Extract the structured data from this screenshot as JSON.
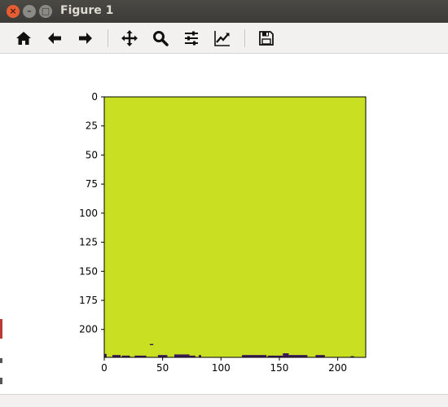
{
  "window": {
    "title": "Figure 1",
    "close_glyph": "×",
    "minimize_glyph": "–",
    "maximize_glyph": "□"
  },
  "toolbar": {
    "buttons": [
      {
        "name": "home-icon",
        "tooltip": ""
      },
      {
        "name": "back-arrow-icon",
        "tooltip": ""
      },
      {
        "name": "forward-arrow-icon",
        "tooltip": ""
      },
      {
        "name": "pan-move-icon",
        "tooltip": ""
      },
      {
        "name": "zoom-magnifier-icon",
        "tooltip": ""
      },
      {
        "name": "configure-subplots-icon",
        "tooltip": ""
      },
      {
        "name": "edit-axis-line-icon",
        "tooltip": ""
      },
      {
        "name": "save-floppy-icon",
        "tooltip": ""
      }
    ]
  },
  "colors": {
    "image_fill": "#c8e021",
    "dark_pixels": "#3b1a55",
    "axis": "#000000"
  },
  "chart_data": {
    "type": "heatmap",
    "title": "",
    "xlabel": "",
    "ylabel": "",
    "xlim": [
      0,
      224
    ],
    "ylim": [
      224,
      0
    ],
    "xticks": [
      0,
      50,
      100,
      150,
      200
    ],
    "yticks": [
      0,
      25,
      50,
      75,
      100,
      125,
      150,
      175,
      200
    ],
    "grid": false,
    "fill_value": "high",
    "dark_regions": [
      {
        "x0": 0,
        "x1": 2,
        "y0": 221,
        "y1": 224
      },
      {
        "x0": 7,
        "x1": 14,
        "y0": 222,
        "y1": 224
      },
      {
        "x0": 15,
        "x1": 22,
        "y0": 222.5,
        "y1": 224
      },
      {
        "x0": 26,
        "x1": 36,
        "y0": 222.5,
        "y1": 224
      },
      {
        "x0": 39,
        "x1": 42,
        "y0": 212.5,
        "y1": 213.5
      },
      {
        "x0": 46,
        "x1": 54,
        "y0": 222,
        "y1": 224
      },
      {
        "x0": 60,
        "x1": 73,
        "y0": 221.5,
        "y1": 224
      },
      {
        "x0": 73,
        "x1": 78,
        "y0": 222.5,
        "y1": 224
      },
      {
        "x0": 81,
        "x1": 83,
        "y0": 222,
        "y1": 224
      },
      {
        "x0": 118,
        "x1": 139,
        "y0": 222,
        "y1": 224
      },
      {
        "x0": 140,
        "x1": 153,
        "y0": 222.5,
        "y1": 224
      },
      {
        "x0": 153,
        "x1": 158,
        "y0": 220.5,
        "y1": 224
      },
      {
        "x0": 158,
        "x1": 174,
        "y0": 222,
        "y1": 224
      },
      {
        "x0": 181,
        "x1": 189,
        "y0": 222,
        "y1": 224
      },
      {
        "x0": 211,
        "x1": 214,
        "y0": 223,
        "y1": 224
      }
    ]
  }
}
